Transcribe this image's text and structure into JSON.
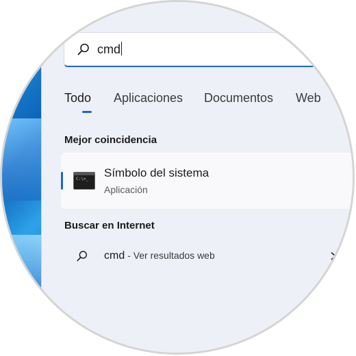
{
  "search": {
    "query": "cmd"
  },
  "tabs": [
    {
      "label": "Todo",
      "active": true
    },
    {
      "label": "Aplicaciones",
      "active": false
    },
    {
      "label": "Documentos",
      "active": false
    },
    {
      "label": "Web",
      "active": false
    }
  ],
  "best_match": {
    "section_title": "Mejor coincidencia",
    "title": "Símbolo del sistema",
    "subtitle": "Aplicación",
    "icon": "command-prompt-icon"
  },
  "web_search": {
    "section_title": "Buscar en Internet",
    "term": "cmd",
    "separator": " - ",
    "description": "Ver resultados web",
    "icon": "search-icon"
  },
  "colors": {
    "accent": "#1b66c9",
    "panel_bg": "#eef0f8",
    "result_bg": "#f9f9fb"
  }
}
